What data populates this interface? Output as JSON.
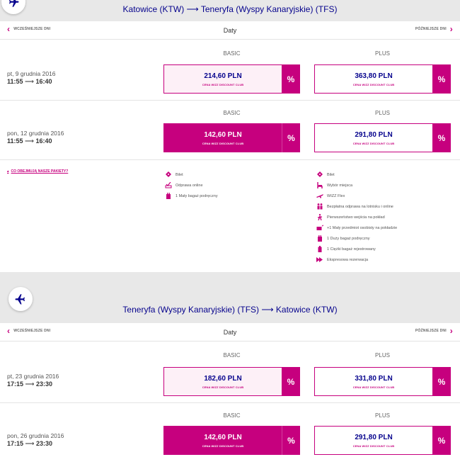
{
  "colors": {
    "brand_magenta": "#c6007e",
    "brand_navy": "#06038d",
    "light_pink": "#fdf0f7"
  },
  "outbound": {
    "route_title": "Katowice (KTW) ⟶ Teneryfa (Wyspy Kanaryjskie) (TFS)",
    "nav": {
      "prev_label": "WCZEŚNIEJSZE DNI",
      "center_label": "Daty",
      "next_label": "PÓŹNIEJSZE DNI"
    },
    "flights": [
      {
        "date": "pt, 9 grudnia 2016",
        "time_dep": "11:55",
        "time_arr": "16:40",
        "basic": {
          "header": "BASIC",
          "price": "214,60 PLN",
          "club": "CENA WIZZ DISCOUNT CLUB",
          "pct": "%"
        },
        "plus": {
          "header": "PLUS",
          "price": "363,80 PLN",
          "club": "CENA WIZZ DISCOUNT CLUB",
          "pct": "%"
        }
      },
      {
        "date": "pon, 12 grudnia 2016",
        "time_dep": "11:55",
        "time_arr": "16:40",
        "basic": {
          "header": "BASIC",
          "price": "142,60 PLN",
          "club": "CENA WIZZ DISCOUNT CLUB",
          "pct": "%"
        },
        "plus": {
          "header": "PLUS",
          "price": "291,80 PLN",
          "club": "CENA WIZZ DISCOUNT CLUB",
          "pct": "%"
        }
      }
    ],
    "packages_link": "CO OBEJMUJĄ NASZE PAKIETY?",
    "basic_features": [
      {
        "icon": "ticket-icon",
        "label": "Bilet"
      },
      {
        "icon": "checkin-icon",
        "label": "Odprawa online"
      },
      {
        "icon": "small-bag-icon",
        "label": "1 Mały bagaż podręczny"
      }
    ],
    "plus_features": [
      {
        "icon": "ticket-icon",
        "label": "Bilet"
      },
      {
        "icon": "seat-icon",
        "label": "Wybór miejsca"
      },
      {
        "icon": "plane-flex-icon",
        "label": "WIZZ Flex"
      },
      {
        "icon": "people-checkin-icon",
        "label": "Bezpłatna odprawa na lotnisku i online"
      },
      {
        "icon": "priority-boarding-icon",
        "label": "Pierwszeństwo wejścia na pokład"
      },
      {
        "icon": "personal-item-icon",
        "label": "+1 Mały przedmiot osobisty na pokładzie"
      },
      {
        "icon": "cabin-bag-icon",
        "label": "1 Duży bagaż podręczny"
      },
      {
        "icon": "checked-bag-icon",
        "label": "1 Ciężki bagaż rejestrowany"
      },
      {
        "icon": "express-icon",
        "label": "Ekspresowa rezerwacja"
      }
    ]
  },
  "return": {
    "route_title": "Teneryfa (Wyspy Kanaryjskie) (TFS) ⟶ Katowice (KTW)",
    "nav": {
      "prev_label": "WCZEŚNIEJSZE DNI",
      "center_label": "Daty",
      "next_label": "PÓŹNIEJSZE DNI"
    },
    "flights": [
      {
        "date": "pt, 23 grudnia 2016",
        "time_dep": "17:15",
        "time_arr": "23:30",
        "basic": {
          "header": "BASIC",
          "price": "182,60 PLN",
          "club": "CENA WIZZ DISCOUNT CLUB",
          "pct": "%"
        },
        "plus": {
          "header": "PLUS",
          "price": "331,80 PLN",
          "club": "CENA WIZZ DISCOUNT CLUB",
          "pct": "%"
        }
      },
      {
        "date": "pon, 26 grudnia 2016",
        "time_dep": "17:15",
        "time_arr": "23:30",
        "basic": {
          "header": "BASIC",
          "price": "142,60 PLN",
          "club": "CENA WIZZ DISCOUNT CLUB",
          "pct": "%"
        },
        "plus": {
          "header": "PLUS",
          "price": "291,80 PLN",
          "club": "CENA WIZZ DISCOUNT CLUB",
          "pct": "%"
        }
      }
    ]
  }
}
